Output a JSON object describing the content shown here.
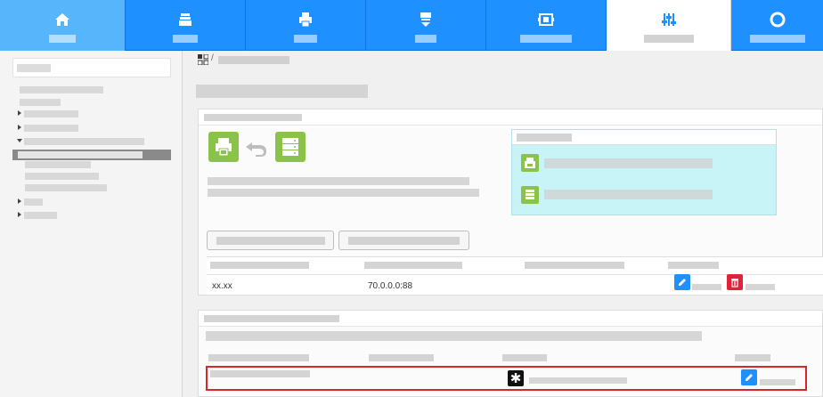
{
  "nav": {
    "tabs": [
      {
        "name": "home",
        "icon": "home-icon",
        "active": false
      },
      {
        "name": "tray",
        "icon": "tray-icon",
        "active": false
      },
      {
        "name": "print",
        "icon": "printer-icon",
        "active": false
      },
      {
        "name": "download",
        "icon": "download-icon",
        "active": false
      },
      {
        "name": "network",
        "icon": "network-icon",
        "active": false
      },
      {
        "name": "settings",
        "icon": "sliders-icon",
        "active": true
      },
      {
        "name": "support",
        "icon": "lifebuoy-icon",
        "active": false
      }
    ]
  },
  "breadcrumb": {
    "separator": "/"
  },
  "table": {
    "rows": [
      {
        "col1": "xx.xx",
        "col2": "70.0.0.0:88"
      }
    ]
  },
  "colors": {
    "nav_blue": "#1e90ff",
    "accent_green": "#8bc34a",
    "edit_blue": "#1e90ff",
    "delete_red": "#e0223b",
    "highlight_red": "#d9262b",
    "info_box": "#c8f3f7"
  }
}
